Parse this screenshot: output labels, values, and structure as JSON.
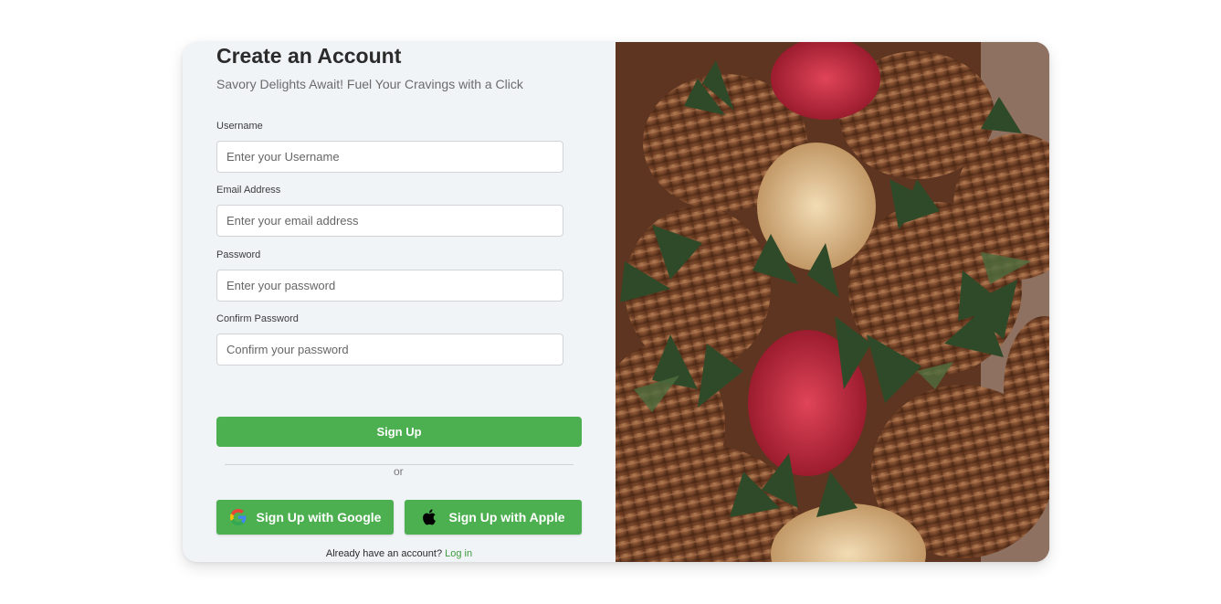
{
  "form": {
    "title": "Create an Account",
    "subtitle": "Savory Delights Await! Fuel Your Cravings with a Click",
    "fields": [
      {
        "label": "Username",
        "placeholder": "Enter your Username",
        "value": ""
      },
      {
        "label": "Email Address",
        "placeholder": "Enter your email address",
        "value": ""
      },
      {
        "label": "Password",
        "placeholder": "Enter your password",
        "value": ""
      },
      {
        "label": "Confirm Password",
        "placeholder": "Confirm your password",
        "value": ""
      }
    ],
    "signup_label": "Sign Up",
    "divider_text": "or",
    "google_label": "Sign Up with Google",
    "apple_label": "Sign Up with Apple",
    "login_prompt": "Already have an account?",
    "login_link": "Log in"
  },
  "icons": {
    "google": "google-icon",
    "apple": "apple-icon"
  },
  "colors": {
    "accent": "#4caf50",
    "link": "#3c9a40",
    "panel_bg": "#f1f4f7",
    "chocolate": "#7a4a2c",
    "strawberry_leaf": "#2f4a28",
    "raspberry_crumble": "#c0263c",
    "nut_crumble": "#e3c89a"
  }
}
